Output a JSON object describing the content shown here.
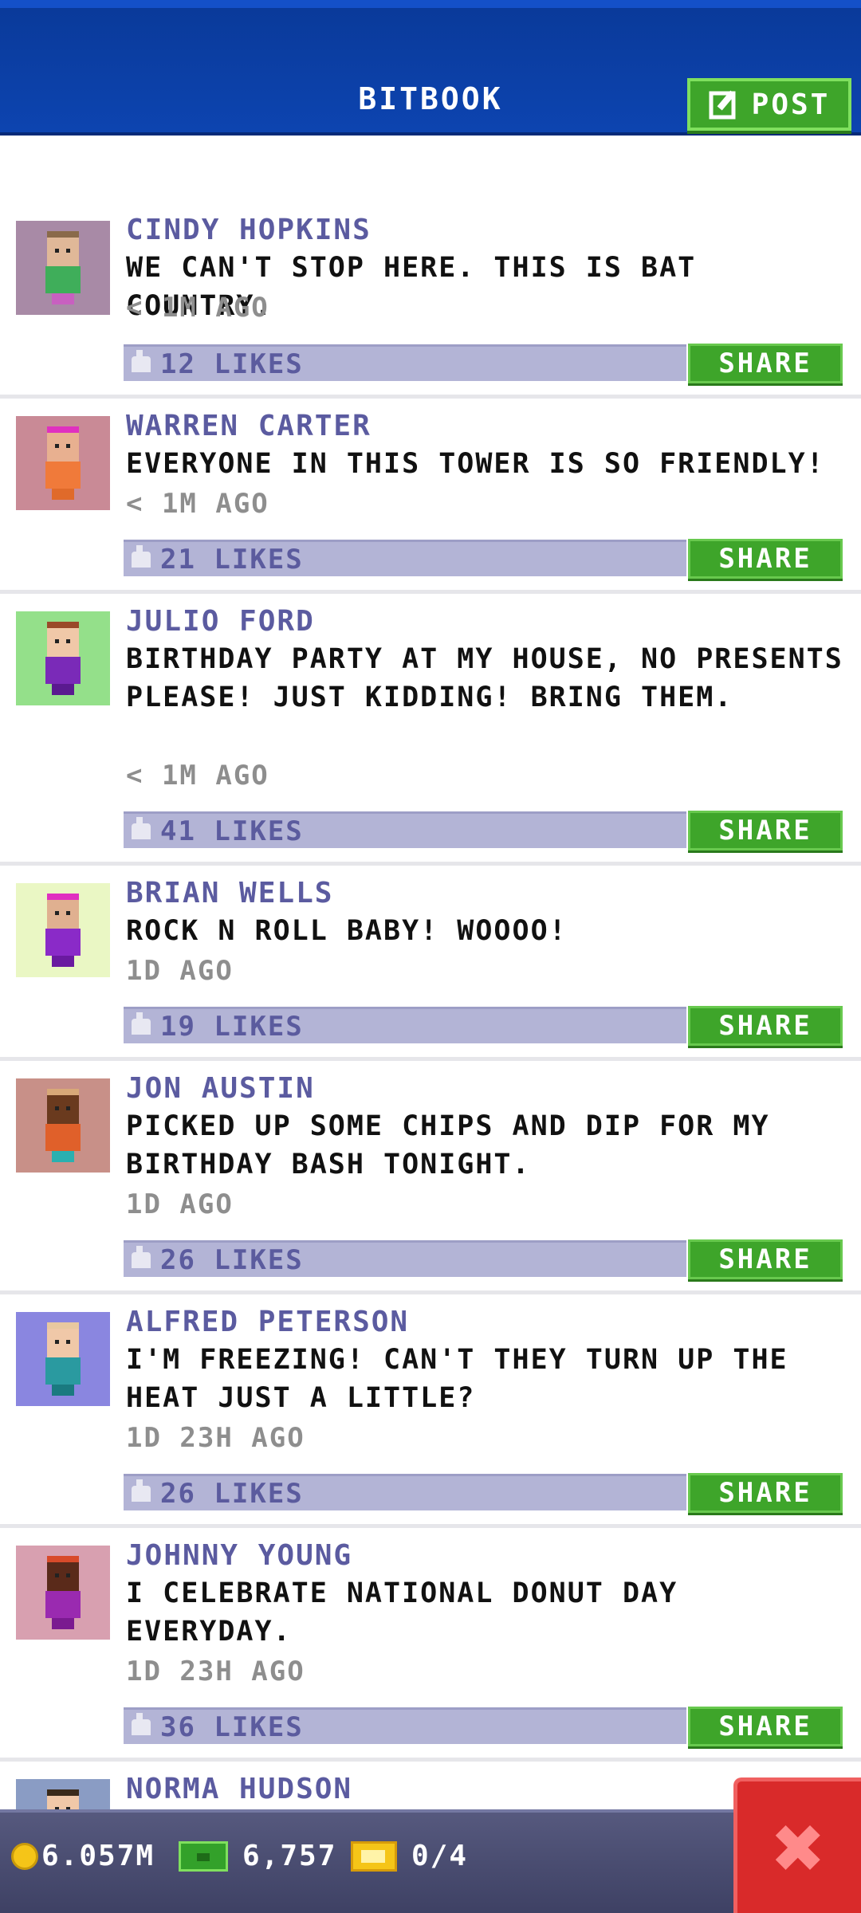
{
  "header": {
    "title": "BITBOOK",
    "post_label": "POST"
  },
  "posts": [
    {
      "name": "CINDY HOPKINS",
      "text": "WE CAN'T STOP HERE. THIS IS BAT COUNTRY.",
      "time": "< 1M AGO",
      "likes": "12 LIKES",
      "share": "SHARE",
      "avatar_bg": "#a88aa6"
    },
    {
      "name": "WARREN CARTER",
      "text": "EVERYONE IN THIS TOWER IS SO FRIENDLY!",
      "time": "< 1M AGO",
      "likes": "21 LIKES",
      "share": "SHARE",
      "avatar_bg": "#c98a96"
    },
    {
      "name": "JULIO FORD",
      "text": "BIRTHDAY PARTY AT MY HOUSE, NO PRESENTS PLEASE! JUST KIDDING! BRING THEM.",
      "time": "< 1M AGO",
      "likes": "41 LIKES",
      "share": "SHARE",
      "avatar_bg": "#94e08a"
    },
    {
      "name": "BRIAN WELLS",
      "text": "ROCK N ROLL BABY! WOOOO!",
      "time": "1D AGO",
      "likes": "19 LIKES",
      "share": "SHARE",
      "avatar_bg": "#eaf7c4"
    },
    {
      "name": "JON AUSTIN",
      "text": "PICKED UP SOME CHIPS AND DIP FOR MY BIRTHDAY BASH TONIGHT.",
      "time": "1D AGO",
      "likes": "26 LIKES",
      "share": "SHARE",
      "avatar_bg": "#c89088"
    },
    {
      "name": "ALFRED PETERSON",
      "text": "I'M FREEZING! CAN'T THEY TURN UP THE HEAT JUST A LITTLE?",
      "time": "1D 23H AGO",
      "likes": "26 LIKES",
      "share": "SHARE",
      "avatar_bg": "#8a86e0"
    },
    {
      "name": "JOHNNY YOUNG",
      "text": "I CELEBRATE NATIONAL DONUT DAY EVERYDAY.",
      "time": "1D 23H AGO",
      "likes": "36 LIKES",
      "share": "SHARE",
      "avatar_bg": "#d8a0b0"
    },
    {
      "name": "NORMA HUDSON",
      "avatar_bg": "#8a9cc4"
    }
  ],
  "bottom_bar": {
    "coins": "6.057M",
    "bux": "6,757",
    "tickets": "0/4"
  },
  "colors": {
    "header_blue": "#0d44b0",
    "share_green": "#3ea52a",
    "likes_bar": "#b3b4d6",
    "name_purple": "#5b5ba0",
    "close_red": "#d92a2a"
  },
  "icons": [
    "edit-icon",
    "like-icon",
    "coin-icon",
    "bux-icon",
    "ticket-icon",
    "close-icon"
  ]
}
